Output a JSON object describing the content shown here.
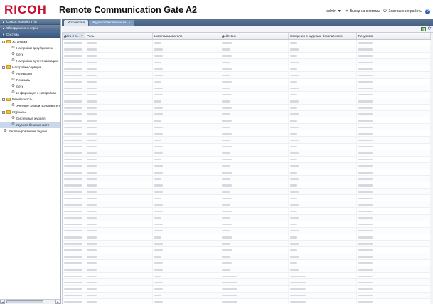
{
  "header": {
    "brand": "RICOH",
    "title": "Remote Communication Gate A2",
    "user": "admin",
    "logout_label": "Выход из системы",
    "shutdown_label": "Завершение работы",
    "help_label": "?",
    "user_chevron": "▼",
    "logout_icon": "logout-icon",
    "shutdown_icon": "power-icon",
    "brand_color": "#c8102e"
  },
  "sidebar": {
    "accordion": [
      {
        "label": "Список устройств (4)",
        "chevron": "▲"
      },
      {
        "label": "Обнаружение и опрос",
        "chevron": "▲"
      },
      {
        "label": "Система",
        "chevron": "▼"
      }
    ],
    "tree": [
      {
        "label": "Установка",
        "toggle": "–"
      },
      {
        "label": "Настройки дату/времени"
      },
      {
        "label": "Сеть"
      },
      {
        "label": "Настройка аутентификации"
      },
      {
        "label": "Настройки сервера",
        "toggle": "–"
      },
      {
        "label": "Активация"
      },
      {
        "label": "Показать"
      },
      {
        "label": "Сеть"
      },
      {
        "label": "Информация о настройках"
      },
      {
        "label": "Безопасность",
        "toggle": "–"
      },
      {
        "label": "Учетные записи пользователей"
      },
      {
        "label": "Журналы",
        "toggle": "–"
      },
      {
        "label": "Системный журнал"
      },
      {
        "label": "Журнал безопасности"
      },
      {
        "label": "Запланированные задачи"
      }
    ],
    "scroll_left": "◄",
    "scroll_right": "►"
  },
  "tabs": [
    {
      "label": "Устройства"
    },
    {
      "label": "Журнал безопасности",
      "close": "×"
    }
  ],
  "grid": {
    "columns": [
      "Дата и в...",
      "Роль",
      "Имя пользователя",
      "Действие",
      "Сведения о журнале безопасности",
      "Результат"
    ],
    "sort_indicator": "▼",
    "row_count": 42
  }
}
